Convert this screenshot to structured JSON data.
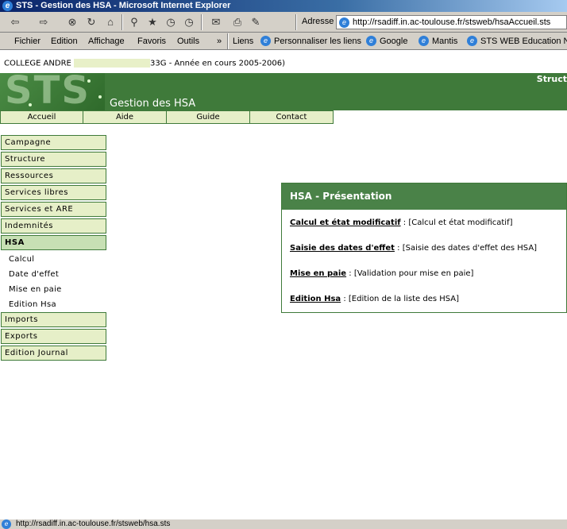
{
  "window": {
    "title": "STS - Gestion des HSA - Microsoft Internet Explorer"
  },
  "toolbar": {
    "back_icon": "⇦",
    "forward_icon": "⇨",
    "stop_icon": "⊗",
    "refresh_icon": "↻",
    "home_icon": "⌂",
    "search_icon": "⚲",
    "favorites_icon": "★",
    "history_icon": "◷",
    "mail_icon": "✉",
    "print_icon": "⎙",
    "edit_icon": "✎",
    "address_label": "Adresse",
    "address_value": "http://rsadiff.in.ac-toulouse.fr/stsweb/hsaAccueil.sts"
  },
  "menubar": {
    "items": [
      "Fichier",
      "Edition",
      "Affichage",
      "Favoris",
      "Outils"
    ],
    "more": "»",
    "links_label": "Liens",
    "links": [
      "Personnaliser les liens",
      "Google",
      "Mantis",
      "STS WEB Education N"
    ]
  },
  "page": {
    "college_prefix": "COLLEGE ANDRE",
    "college_suffix": "33G - Année en cours 2005-2006)",
    "logo_text": "STS",
    "app_title": "Gestion des HSA",
    "banner_right": "Struct",
    "top_nav": [
      "Accueil",
      "Aide",
      "Guide",
      "Contact"
    ],
    "side_menu_top": [
      "Campagne",
      "Structure",
      "Ressources",
      "Services libres",
      "Services et ARE",
      "Indemnités"
    ],
    "side_menu_active": "HSA",
    "side_sub_items": [
      "Calcul",
      "Date d'effet",
      "Mise en paie",
      "Edition Hsa"
    ],
    "side_menu_bottom": [
      "Imports",
      "Exports",
      "Edition Journal"
    ]
  },
  "panel": {
    "title": "HSA - Présentation",
    "rows": [
      {
        "link": "Calcul et état modificatif",
        "desc": " : [Calcul et état modificatif]"
      },
      {
        "link": "Saisie des dates d'effet",
        "desc": " : [Saisie des dates d'effet des HSA]"
      },
      {
        "link": "Mise en paie",
        "desc": " : [Validation pour mise en paie]"
      },
      {
        "link": "Edition Hsa",
        "desc": " : [Edition de la liste des HSA]"
      }
    ]
  },
  "status": {
    "text": "http://rsadiff.in.ac-toulouse.fr/stsweb/hsa.sts"
  },
  "colors": {
    "banner_green": "#3f7a3a",
    "menu_bg": "#e6efc8",
    "panel_head": "#4a8248"
  }
}
